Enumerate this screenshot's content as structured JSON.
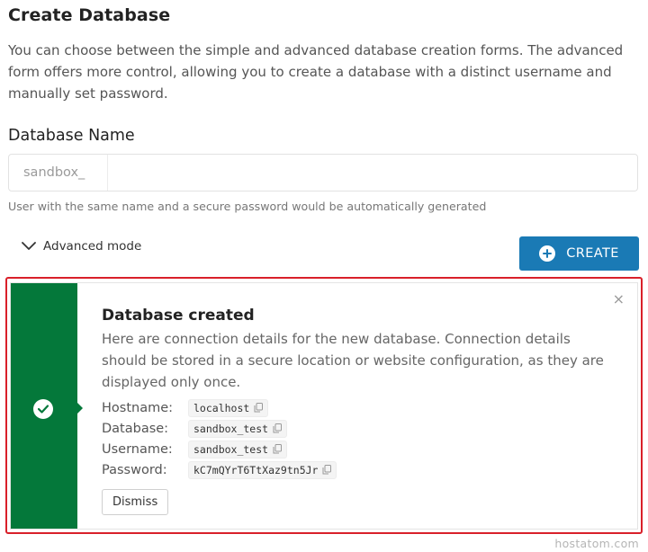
{
  "page": {
    "title": "Create Database",
    "intro": "You can choose between the simple and advanced database creation forms. The advanced form offers more control, allowing you to create a database with a distinct username and manually set password."
  },
  "form": {
    "label": "Database Name",
    "prefix": "sandbox_",
    "value": "",
    "hint": "User with the same name and a secure password would be automatically generated",
    "advanced_label": "Advanced mode",
    "create_label": "CREATE"
  },
  "notice": {
    "title": "Database created",
    "text": "Here are connection details for the new database. Connection details should be stored in a secure location or website configuration, as they are displayed only once.",
    "close": "×",
    "details": [
      {
        "label": "Hostname:",
        "value": "localhost"
      },
      {
        "label": "Database:",
        "value": "sandbox_test"
      },
      {
        "label": "Username:",
        "value": "sandbox_test"
      },
      {
        "label": "Password:",
        "value": "kC7mQYrT6TtXaz9tn5Jr"
      }
    ],
    "dismiss_label": "Dismiss"
  },
  "colors": {
    "accent": "#1a7ab5",
    "success": "#04783a",
    "highlight": "#d9202a"
  },
  "icons": {
    "advanced": "chevron-down-icon",
    "create": "plus-circle-icon",
    "success": "check-circle-icon",
    "close": "close-icon",
    "copy": "copy-icon"
  },
  "watermark": "hostatom.com"
}
